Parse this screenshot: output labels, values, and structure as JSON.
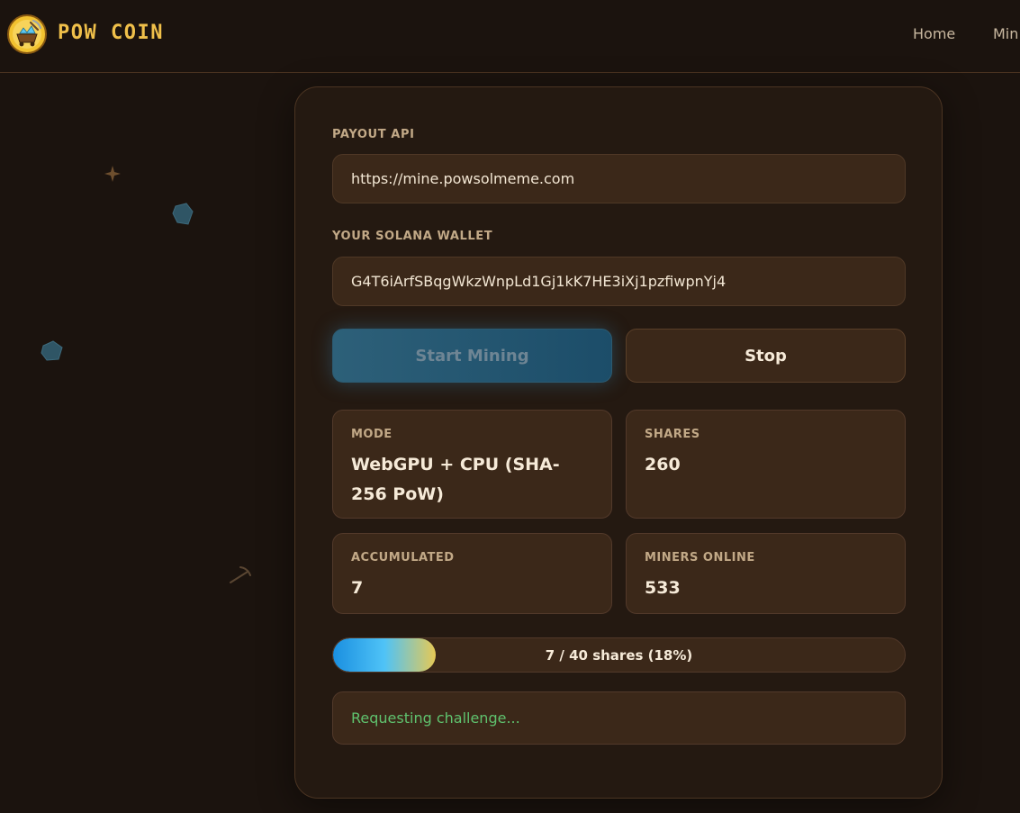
{
  "header": {
    "brand": "POW COIN",
    "nav": [
      "Home",
      "Min"
    ]
  },
  "form": {
    "payout_label": "PAYOUT API",
    "payout_value": "https://mine.powsolmeme.com",
    "wallet_label": "YOUR SOLANA WALLET",
    "wallet_value": "G4T6iArfSBqgWkzWnpLd1Gj1kK7HE3iXj1pzfiwpnYj4"
  },
  "buttons": {
    "start": "Start Mining",
    "stop": "Stop",
    "start_enabled": false
  },
  "stats": [
    {
      "label": "MODE",
      "value": "WebGPU + CPU (SHA-256 PoW)"
    },
    {
      "label": "SHARES",
      "value": "260"
    },
    {
      "label": "ACCUMULATED",
      "value": "7"
    },
    {
      "label": "MINERS ONLINE",
      "value": "533"
    }
  ],
  "progress": {
    "text": "7 / 40 shares (18%)",
    "fraction": 0.18
  },
  "status": {
    "text": "Requesting challenge...",
    "color": "#5fc26e"
  },
  "icons": {
    "logo": "mining-cart-logo-icon",
    "sparkle": "sparkle-icon",
    "gem": "gem-icon",
    "pickaxe": "pickaxe-icon"
  },
  "colors": {
    "background": "#1b130e",
    "card": "#241911",
    "accent": "#f0c04a"
  }
}
